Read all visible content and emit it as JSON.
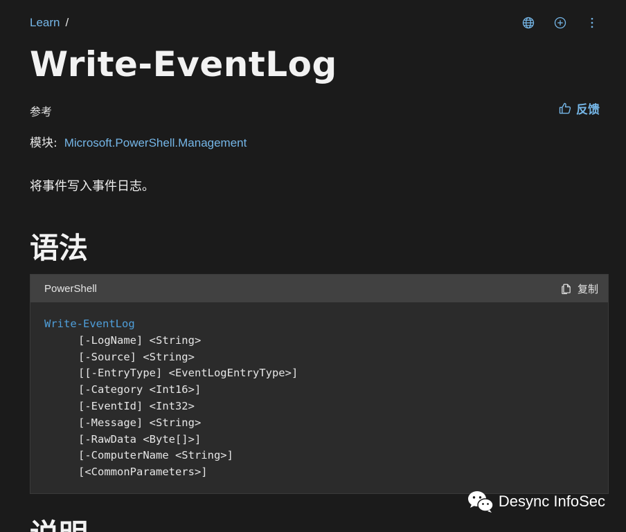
{
  "breadcrumb": {
    "home": "Learn",
    "separator": "/"
  },
  "top_icons": [
    "globe-icon",
    "add-circle-icon",
    "more-vertical-icon"
  ],
  "title": "Write-EventLog",
  "reference_label": "参考",
  "feedback_label": "反馈",
  "module": {
    "label": "模块:",
    "link": "Microsoft.PowerShell.Management"
  },
  "summary": "将事件写入事件日志。",
  "syntax_heading": "语法",
  "code": {
    "language": "PowerShell",
    "copy_label": "复制",
    "command": "Write-EventLog",
    "params": [
      "[-LogName] <String>",
      "[-Source] <String>",
      "[[-EntryType] <EventLogEntryType>]",
      "[-Category <Int16>]",
      "[-EventId] <Int32>",
      "[-Message] <String>",
      "[-RawData <Byte[]>]",
      "[-ComputerName <String>]",
      "[<CommonParameters>]"
    ]
  },
  "watermark": "Desync InfoSec",
  "next_heading": "说明",
  "colors": {
    "background": "#1b1b1b",
    "link": "#75b6e7",
    "code_bg": "#2b2b2b",
    "code_header": "#414141",
    "command": "#4f9fdb"
  }
}
